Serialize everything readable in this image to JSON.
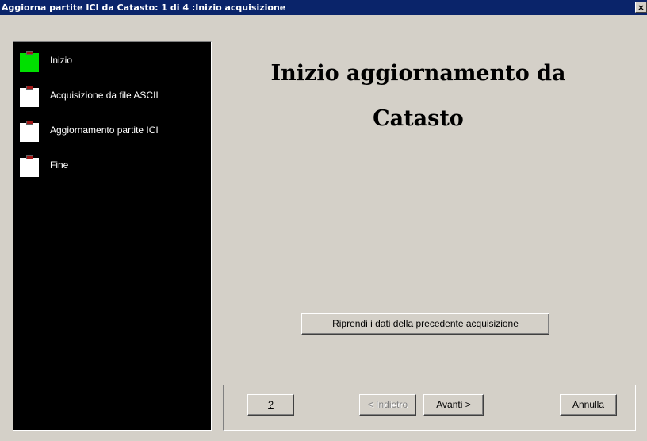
{
  "window": {
    "title": "Aggiorna partite ICI da Catasto: 1 di 4 :Inizio acquisizione",
    "close_label": "×"
  },
  "steps": [
    {
      "label": "Inizio",
      "active": true
    },
    {
      "label": "Acquisizione da file ASCII",
      "active": false
    },
    {
      "label": "Aggiornamento partite ICI",
      "active": false
    },
    {
      "label": "Fine",
      "active": false
    }
  ],
  "main": {
    "heading_line1": "Inizio aggiornamento da",
    "heading_line2": "Catasto",
    "resume_button": "Riprendi i dati della precedente acquisizione"
  },
  "footer": {
    "help_label": "?",
    "back_label": "< Indietro",
    "next_label": "Avanti >",
    "cancel_label": "Annulla"
  },
  "colors": {
    "titlebar": "#0a246a",
    "active_step": "#00e000",
    "panel_bg": "#000000"
  }
}
